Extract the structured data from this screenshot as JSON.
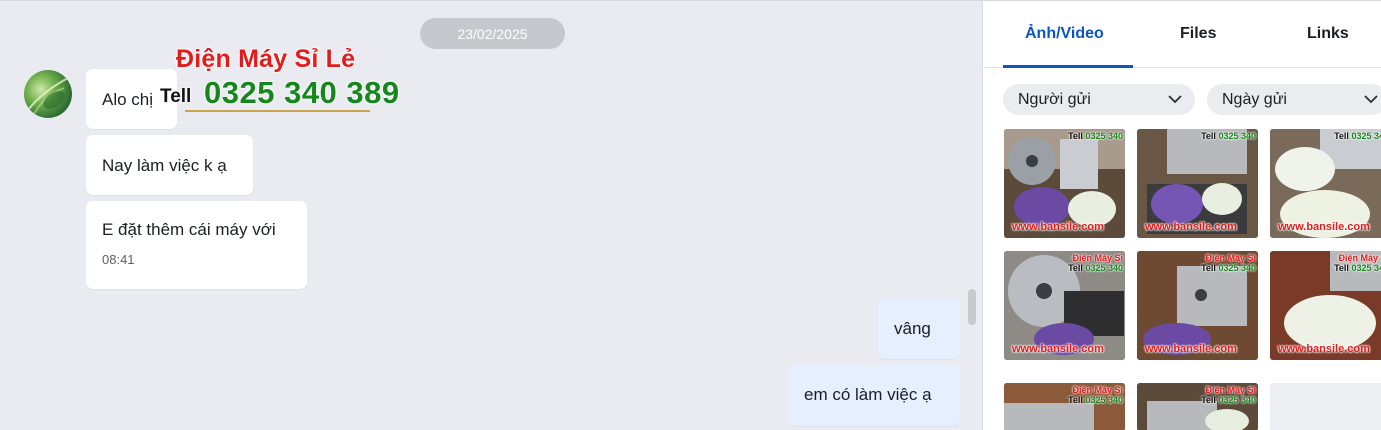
{
  "chat": {
    "date_separator": "23/02/2025",
    "messages": [
      {
        "direction": "incoming",
        "text": "Alo chị"
      },
      {
        "direction": "incoming",
        "text": "Nay làm việc k ạ"
      },
      {
        "direction": "incoming",
        "text": "E đặt thêm cái máy với",
        "time": "08:41"
      },
      {
        "direction": "outgoing",
        "text": "vâng"
      },
      {
        "direction": "outgoing",
        "text": "em có làm việc ạ"
      }
    ]
  },
  "watermark": {
    "brand": "Điện Máy Sỉ Lẻ",
    "tell_label": "Tell",
    "phone": "0325 340 389"
  },
  "panel": {
    "tabs": [
      {
        "label": "Ảnh/Video",
        "active": true
      },
      {
        "label": "Files",
        "active": false
      },
      {
        "label": "Links",
        "active": false
      }
    ],
    "filters": {
      "sender": "Người gửi",
      "date": "Ngày gửi"
    },
    "thumbnail_watermark": {
      "brand": "Điện Máy Sỉ",
      "tell": "Tell",
      "phone": "0325 340",
      "url": "www.bansile.com"
    }
  },
  "icons": {
    "filter_chevron": "chevron-down-icon"
  },
  "colors": {
    "chat_bg": "#eaebf1",
    "outgoing_bubble": "#e5efff",
    "accent": "#0b55c4",
    "watermark_red": "#e21b1b",
    "watermark_green": "#18861f"
  }
}
